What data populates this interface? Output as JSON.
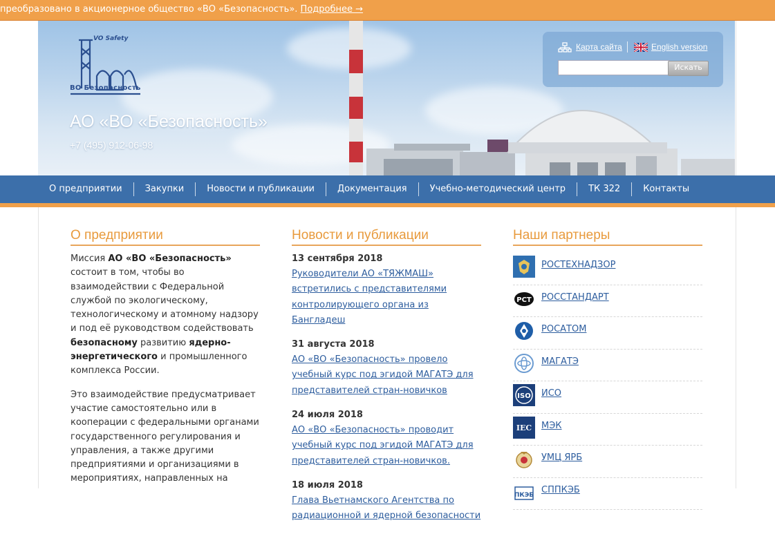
{
  "topbar": {
    "text": "преобразовано в акционерное общество «ВО «Безопасность».",
    "more_link": "Подробнее →"
  },
  "header": {
    "logo_top": "VO Safety",
    "logo_bottom": "ВО Безопасность",
    "company_name": "АО «ВО «Безопасность»",
    "phone": "+7 (495) 912-06-98",
    "sitemap_link": "Карта сайта",
    "english_link": "English version",
    "search_placeholder": "",
    "search_button": "Искать"
  },
  "nav": {
    "items": [
      "О предприятии",
      "Закупки",
      "Новости и публикации",
      "Документация",
      "Учебно-методический центр",
      "ТК 322",
      "Контакты"
    ]
  },
  "about": {
    "title": "О предприятии",
    "p1_parts": [
      "Миссия ",
      "АО «ВО «Безопасность»",
      " состоит в том, чтобы во взаимодействии с Федеральной службой по экологическому, технологическому и атомному надзору и под её руководством содействовать ",
      "безопасному",
      " развитию ",
      "ядерно-энергетического",
      " и промышленного комплекса России."
    ],
    "p2": "Это взаимодействие предусматривает участие самостоятельно или в кооперации с федеральными органами государственного регулирования и управления, а также другими предприятиями и организациями в мероприятиях, направленных на"
  },
  "news": {
    "title": "Новости и публикации",
    "items": [
      {
        "date": "13 сентября 2018",
        "text": "Руководители АО «ТЯЖМАШ» встретились с представителями контролирующего органа из Бангладеш"
      },
      {
        "date": "31 августа 2018",
        "text": "АО «ВО «Безопасность» провело учебный курс под эгидой МАГАТЭ для представителей стран-новичков"
      },
      {
        "date": "24 июля 2018",
        "text": "АО «ВО «Безопасность» проводит учебный курс под эгидой МАГАТЭ для представителей стран-новичков."
      },
      {
        "date": "18 июля 2018",
        "text": "Глава Вьетнамского Агентства по радиационной и ядерной безопасности"
      }
    ]
  },
  "partners": {
    "title": "Наши партнеры",
    "items": [
      {
        "name": "РОСТЕХНАДЗОР",
        "icon": "rostekhnadzor-emblem-icon"
      },
      {
        "name": "РОССТАНДАРТ",
        "icon": "rosstandart-pct-icon"
      },
      {
        "name": "РОСАТОМ",
        "icon": "rosatom-atom-icon"
      },
      {
        "name": "МАГАТЭ",
        "icon": "iaea-emblem-icon"
      },
      {
        "name": "ИСО",
        "icon": "iso-icon"
      },
      {
        "name": "МЭК",
        "icon": "iec-icon"
      },
      {
        "name": "УМЦ ЯРБ",
        "icon": "umc-emblem-icon"
      },
      {
        "name": "СППКЭБ",
        "icon": "sppkeb-icon"
      }
    ]
  },
  "colors": {
    "accent_orange": "#f0a04a",
    "nav_blue": "#3c6faa",
    "link_blue": "#2d5d9e"
  }
}
